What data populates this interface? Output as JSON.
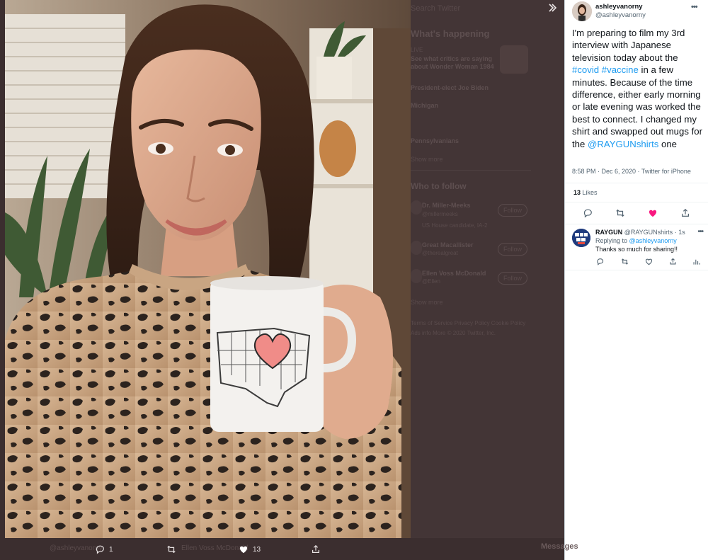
{
  "backdrop": {
    "search_placeholder": "Search Twitter",
    "whats_happening_title": "What's happening",
    "trends": [
      {
        "context": "LIVE",
        "title": "See what critics are saying about Wonder Woman 1984"
      },
      {
        "title": "President-elect Joe Biden"
      },
      {
        "title": "Michigan"
      },
      {
        "title": "Pennsylvanians"
      },
      {
        "title": "Show more"
      }
    ],
    "who_to_follow_title": "Who to follow",
    "suggestions": [
      {
        "name": "Dr. Miller-Meeks",
        "handle": "@millermeeks",
        "follow": "Follow",
        "note": "US House candidate, IA-2"
      },
      {
        "name": "Great Macallister",
        "handle": "@therealgreat",
        "follow": "Follow"
      },
      {
        "name": "Ellen Voss McDonald",
        "handle": "@Ellen",
        "follow": "Follow"
      }
    ],
    "show_more": "Show more",
    "footer": [
      "Terms of Service  Privacy Policy  Cookie Policy",
      "Ads info  More  © 2020 Twitter, Inc."
    ],
    "bar_user": "@ashleyvanorny",
    "bar_user2": "Ellen Voss McDonald",
    "messages": "Messages"
  },
  "viewer": {
    "expand_icon": "chevron-double-right-icon",
    "actions": {
      "replies": "1",
      "retweets": "",
      "likes": "13"
    }
  },
  "tweet": {
    "author_name": "ashleyvanorny",
    "author_handle": "@ashleyvanorny",
    "text_1": "I'm preparing to film my 3rd interview with Japanese television today about the ",
    "hashtag_covid": "#covid",
    "hashtag_vaccine": "#vaccine",
    "text_2": " in a few minutes. Because of the time difference, either early morning or late evening was worked the best to connect. I changed my shirt and swapped out mugs for the ",
    "mention": "@RAYGUNshirts",
    "text_3": " one",
    "meta": "8:58 PM · Dec 6, 2020 · Twitter for iPhone",
    "likes_count": "13",
    "likes_label": "Likes"
  },
  "reply": {
    "name": "RAYGUN",
    "handle": "@RAYGUNshirts",
    "time": "· 1s",
    "replying_label": "Replying to",
    "replying_to": "@ashleyvanorny",
    "text": "Thanks so much for sharing!!",
    "avatar_text": "RAYGUN"
  },
  "colors": {
    "accent": "#1d9bf0",
    "like": "#f91880",
    "backdrop": "#433536"
  }
}
